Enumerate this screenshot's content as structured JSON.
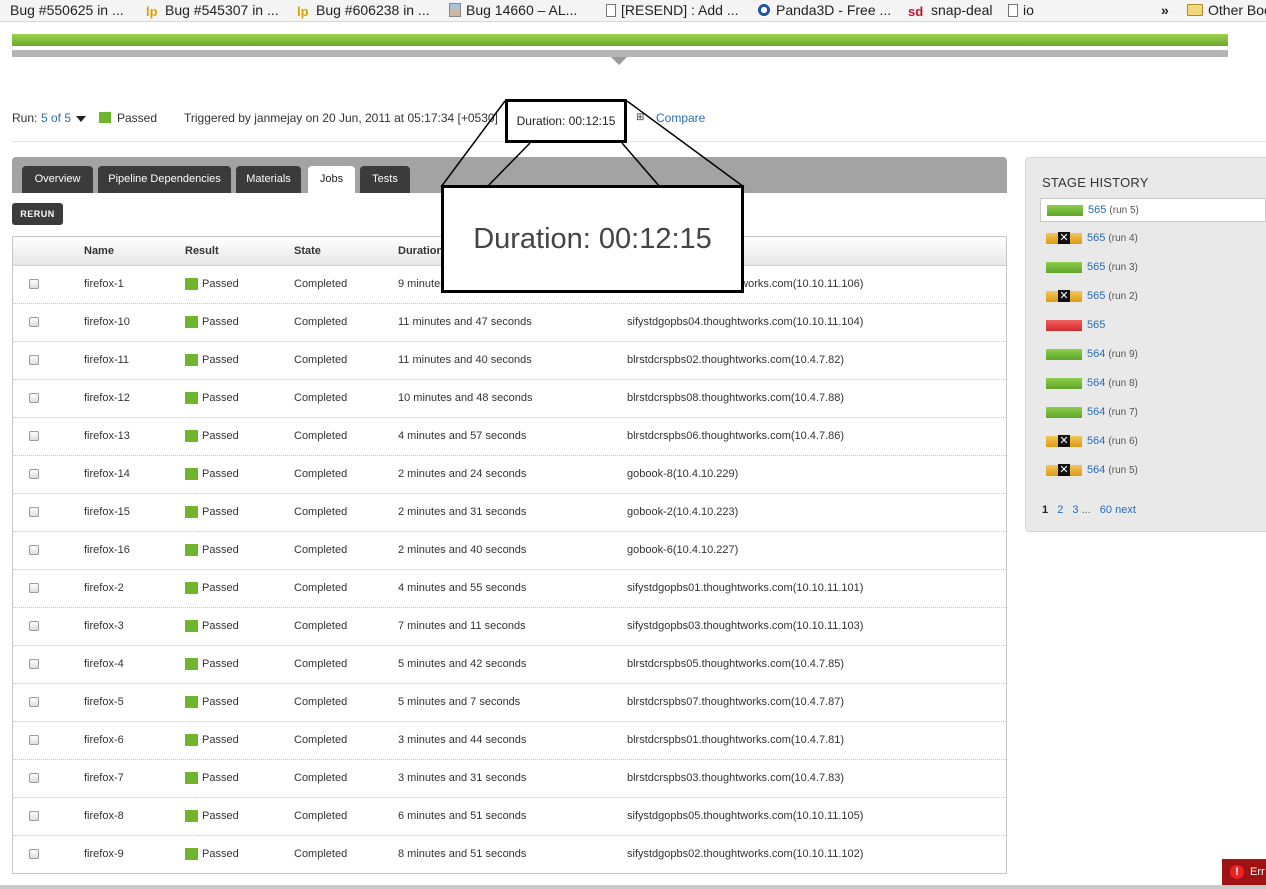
{
  "bookmarks": [
    {
      "label": "Bug #550625 in ...",
      "icon": "launchpad-icon"
    },
    {
      "label": "Bug #545307 in ...",
      "icon": "launchpad-icon"
    },
    {
      "label": "Bug #606238 in ...",
      "icon": "launchpad-icon"
    },
    {
      "label": "Bug 14660 – AL...",
      "icon": "bugzilla-icon"
    },
    {
      "label": "[RESEND] : Add ...",
      "icon": "page-icon"
    },
    {
      "label": "Panda3D - Free ...",
      "icon": "panda3d-icon"
    },
    {
      "label": "snap-deal",
      "icon": "snapdeal-icon"
    },
    {
      "label": "io",
      "icon": "page-icon"
    },
    {
      "label": "»",
      "icon": "overflow-chevron-icon"
    },
    {
      "label": "Other Boo",
      "icon": "folder-icon"
    }
  ],
  "run_info": {
    "run_label": "Run:",
    "run_value": "5 of 5",
    "status": "Passed",
    "triggered": "Triggered by janmejay on 20 Jun, 2011 at 05:17:34 [+0530]",
    "duration": "Duration: 00:12:15",
    "compare": "Compare"
  },
  "tabs": [
    {
      "label": "Overview"
    },
    {
      "label": "Pipeline Dependencies"
    },
    {
      "label": "Materials"
    },
    {
      "label": "Jobs"
    },
    {
      "label": "Tests"
    }
  ],
  "active_tab": "Jobs",
  "rerun_label": "RERUN",
  "jobs_table": {
    "columns": [
      "Name",
      "Result",
      "State",
      "Duration"
    ],
    "rows": [
      {
        "name": "firefox-1",
        "result": "Passed",
        "state": "Completed",
        "duration": "9 minutes",
        "agent": "sifystdgopbs04.thoughtworks.com(10.10.11.106)"
      },
      {
        "name": "firefox-10",
        "result": "Passed",
        "state": "Completed",
        "duration": "11 minutes and 47 seconds",
        "agent": "sifystdgopbs04.thoughtworks.com(10.10.11.104)"
      },
      {
        "name": "firefox-11",
        "result": "Passed",
        "state": "Completed",
        "duration": "11 minutes and 40 seconds",
        "agent": "blrstdcrspbs02.thoughtworks.com(10.4.7.82)"
      },
      {
        "name": "firefox-12",
        "result": "Passed",
        "state": "Completed",
        "duration": "10 minutes and 48 seconds",
        "agent": "blrstdcrspbs08.thoughtworks.com(10.4.7.88)"
      },
      {
        "name": "firefox-13",
        "result": "Passed",
        "state": "Completed",
        "duration": "4 minutes and 57 seconds",
        "agent": "blrstdcrspbs06.thoughtworks.com(10.4.7.86)"
      },
      {
        "name": "firefox-14",
        "result": "Passed",
        "state": "Completed",
        "duration": "2 minutes and 24 seconds",
        "agent": "gobook-8(10.4.10.229)"
      },
      {
        "name": "firefox-15",
        "result": "Passed",
        "state": "Completed",
        "duration": "2 minutes and 31 seconds",
        "agent": "gobook-2(10.4.10.223)"
      },
      {
        "name": "firefox-16",
        "result": "Passed",
        "state": "Completed",
        "duration": "2 minutes and 40 seconds",
        "agent": "gobook-6(10.4.10.227)"
      },
      {
        "name": "firefox-2",
        "result": "Passed",
        "state": "Completed",
        "duration": "4 minutes and 55 seconds",
        "agent": "sifystdgopbs01.thoughtworks.com(10.10.11.101)"
      },
      {
        "name": "firefox-3",
        "result": "Passed",
        "state": "Completed",
        "duration": "7 minutes and 11 seconds",
        "agent": "sifystdgopbs03.thoughtworks.com(10.10.11.103)"
      },
      {
        "name": "firefox-4",
        "result": "Passed",
        "state": "Completed",
        "duration": "5 minutes and 42 seconds",
        "agent": "blrstdcrspbs05.thoughtworks.com(10.4.7.85)"
      },
      {
        "name": "firefox-5",
        "result": "Passed",
        "state": "Completed",
        "duration": "5 minutes and 7 seconds",
        "agent": "blrstdcrspbs07.thoughtworks.com(10.4.7.87)"
      },
      {
        "name": "firefox-6",
        "result": "Passed",
        "state": "Completed",
        "duration": "3 minutes and 44 seconds",
        "agent": "blrstdcrspbs01.thoughtworks.com(10.4.7.81)"
      },
      {
        "name": "firefox-7",
        "result": "Passed",
        "state": "Completed",
        "duration": "3 minutes and 31 seconds",
        "agent": "blrstdcrspbs03.thoughtworks.com(10.4.7.83)"
      },
      {
        "name": "firefox-8",
        "result": "Passed",
        "state": "Completed",
        "duration": "6 minutes and 51 seconds",
        "agent": "sifystdgopbs05.thoughtworks.com(10.10.11.105)"
      },
      {
        "name": "firefox-9",
        "result": "Passed",
        "state": "Completed",
        "duration": "8 minutes and 51 seconds",
        "agent": "sifystdgopbs02.thoughtworks.com(10.10.11.102)"
      }
    ]
  },
  "stage_history": {
    "title": "STAGE HISTORY",
    "items": [
      {
        "counter": "565",
        "run": "(run 5)",
        "status": "passed",
        "current": true
      },
      {
        "counter": "565",
        "run": "(run 4)",
        "status": "cancelled",
        "current": false
      },
      {
        "counter": "565",
        "run": "(run 3)",
        "status": "passed",
        "current": false
      },
      {
        "counter": "565",
        "run": "(run 2)",
        "status": "cancelled",
        "current": false
      },
      {
        "counter": "565",
        "run": "",
        "status": "failed",
        "current": false
      },
      {
        "counter": "564",
        "run": "(run 9)",
        "status": "passed",
        "current": false
      },
      {
        "counter": "564",
        "run": "(run 8)",
        "status": "passed",
        "current": false
      },
      {
        "counter": "564",
        "run": "(run 7)",
        "status": "passed",
        "current": false
      },
      {
        "counter": "564",
        "run": "(run 6)",
        "status": "cancelled",
        "current": false
      },
      {
        "counter": "564",
        "run": "(run 5)",
        "status": "cancelled",
        "current": false
      }
    ],
    "pager": {
      "current": "1",
      "pages": [
        "2",
        "3"
      ],
      "ellipsis": "...",
      "last": "60",
      "next": "next"
    }
  },
  "callout": {
    "text": "Duration: 00:12:15"
  },
  "error_badge": {
    "label": "Err"
  },
  "colors": {
    "passed": "#6fb62f",
    "failed": "#d22a2a",
    "cancelled": "#dd9b13",
    "link": "#2a6bb8",
    "tab_dark": "#3b3b3b"
  }
}
